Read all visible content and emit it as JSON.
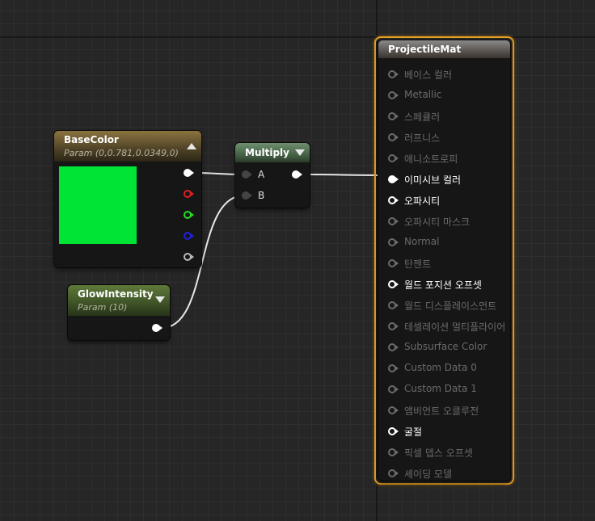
{
  "base_color": {
    "title": "BaseColor",
    "subtitle": "Param (0,0.781,0.0349,0)",
    "swatch_color": "#00e436",
    "outputs": [
      {
        "name": "rgb",
        "color": "#ffffff"
      },
      {
        "name": "r",
        "color": "#e02020"
      },
      {
        "name": "g",
        "color": "#20e020"
      },
      {
        "name": "b",
        "color": "#2020e0"
      },
      {
        "name": "a",
        "color": "#bbbbbb"
      }
    ]
  },
  "multiply": {
    "title": "Multiply",
    "input_a": "A",
    "input_b": "B"
  },
  "glow": {
    "title": "GlowIntensity",
    "subtitle": "Param (10)"
  },
  "material": {
    "title": "ProjectileMat",
    "inputs": [
      {
        "label": "베이스 컬러",
        "active": false
      },
      {
        "label": "Metallic",
        "active": false
      },
      {
        "label": "스페큘러",
        "active": false
      },
      {
        "label": "러프니스",
        "active": false
      },
      {
        "label": "애니소트로피",
        "active": false
      },
      {
        "label": "이미시브 컬러",
        "active": true
      },
      {
        "label": "오파시티",
        "active": true
      },
      {
        "label": "오파시티 마스크",
        "active": false
      },
      {
        "label": "Normal",
        "active": false
      },
      {
        "label": "탄젠트",
        "active": false
      },
      {
        "label": "월드 포지션 오프셋",
        "active": true
      },
      {
        "label": "월드 디스플레이스먼트",
        "active": false
      },
      {
        "label": "테셀레이션 멀티플라이어",
        "active": false
      },
      {
        "label": "Subsurface Color",
        "active": false
      },
      {
        "label": "Custom Data 0",
        "active": false
      },
      {
        "label": "Custom Data 1",
        "active": false
      },
      {
        "label": "앰비언트 오클루전",
        "active": false
      },
      {
        "label": "굴절",
        "active": true
      },
      {
        "label": "픽셀 뎁스 오프셋",
        "active": false
      },
      {
        "label": "셰이딩 모델",
        "active": false
      }
    ]
  },
  "colors": {
    "selection_outline": "#e8a020",
    "wire": "#e6e6e6"
  }
}
